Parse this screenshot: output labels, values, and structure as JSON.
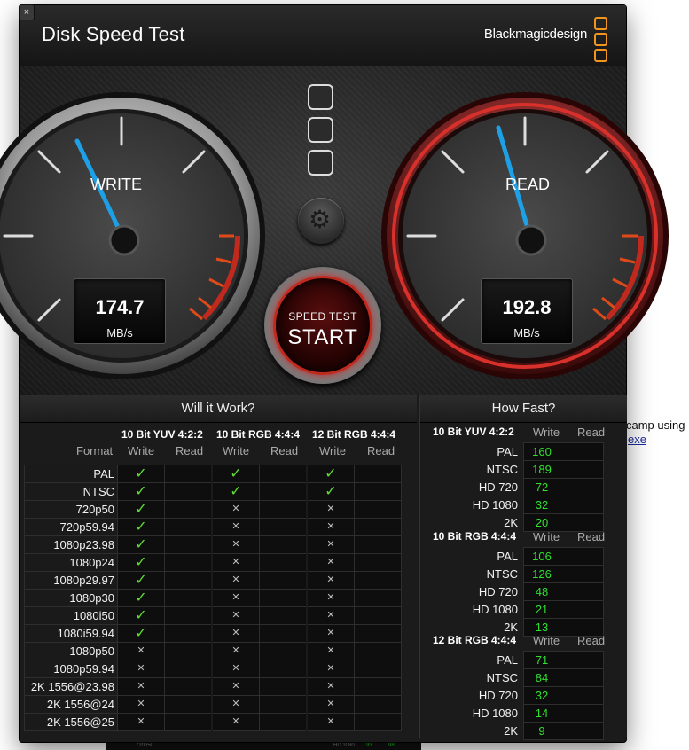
{
  "app": {
    "title": "Disk Speed Test",
    "brand": "Blackmagicdesign",
    "close_symbol": "×"
  },
  "colors": {
    "write_needle": "#1ea0e6",
    "ok_check": "#5fdc35",
    "speed_value": "#30e030",
    "start_ring": "#c0291e",
    "brand_logo": "#f0961e"
  },
  "gauges": {
    "write": {
      "label": "WRITE",
      "value": "174.7",
      "unit": "MB/s"
    },
    "read": {
      "label": "READ",
      "value": "192.8",
      "unit": "MB/s"
    }
  },
  "start_button": {
    "small": "SPEED TEST",
    "big": "START"
  },
  "will_it_work": {
    "title": "Will it Work?",
    "format_label": "Format",
    "write_label": "Write",
    "read_label": "Read",
    "groups": [
      "10 Bit YUV 4:2:2",
      "10 Bit RGB 4:4:4",
      "12 Bit RGB 4:4:4"
    ],
    "rows": [
      {
        "format": "PAL",
        "marks": [
          "ok",
          "ok",
          "ok"
        ]
      },
      {
        "format": "NTSC",
        "marks": [
          "ok",
          "ok",
          "ok"
        ]
      },
      {
        "format": "720p50",
        "marks": [
          "ok",
          "no",
          "no"
        ]
      },
      {
        "format": "720p59.94",
        "marks": [
          "ok",
          "no",
          "no"
        ]
      },
      {
        "format": "1080p23.98",
        "marks": [
          "ok",
          "no",
          "no"
        ]
      },
      {
        "format": "1080p24",
        "marks": [
          "ok",
          "no",
          "no"
        ]
      },
      {
        "format": "1080p29.97",
        "marks": [
          "ok",
          "no",
          "no"
        ]
      },
      {
        "format": "1080p30",
        "marks": [
          "ok",
          "no",
          "no"
        ]
      },
      {
        "format": "1080i50",
        "marks": [
          "ok",
          "no",
          "no"
        ]
      },
      {
        "format": "1080i59.94",
        "marks": [
          "ok",
          "no",
          "no"
        ]
      },
      {
        "format": "1080p50",
        "marks": [
          "no",
          "no",
          "no"
        ]
      },
      {
        "format": "1080p59.94",
        "marks": [
          "no",
          "no",
          "no"
        ]
      },
      {
        "format": "2K 1556@23.98",
        "marks": [
          "no",
          "no",
          "no"
        ]
      },
      {
        "format": "2K 1556@24",
        "marks": [
          "no",
          "no",
          "no"
        ]
      },
      {
        "format": "2K 1556@25",
        "marks": [
          "no",
          "no",
          "no"
        ]
      }
    ]
  },
  "how_fast": {
    "title": "How Fast?",
    "write_label": "Write",
    "read_label": "Read",
    "groups": [
      {
        "name": "10 Bit YUV 4:2:2",
        "rows": [
          {
            "format": "PAL",
            "write": "160"
          },
          {
            "format": "NTSC",
            "write": "189"
          },
          {
            "format": "HD 720",
            "write": "72"
          },
          {
            "format": "HD 1080",
            "write": "32"
          },
          {
            "format": "2K",
            "write": "20"
          }
        ]
      },
      {
        "name": "10 Bit RGB 4:4:4",
        "rows": [
          {
            "format": "PAL",
            "write": "106"
          },
          {
            "format": "NTSC",
            "write": "126"
          },
          {
            "format": "HD 720",
            "write": "48"
          },
          {
            "format": "HD 1080",
            "write": "21"
          },
          {
            "format": "2K",
            "write": "13"
          }
        ]
      },
      {
        "name": "12 Bit RGB 4:4:4",
        "rows": [
          {
            "format": "PAL",
            "write": "71"
          },
          {
            "format": "NTSC",
            "write": "84"
          },
          {
            "format": "HD 720",
            "write": "32"
          },
          {
            "format": "HD 1080",
            "write": "14"
          },
          {
            "format": "2K",
            "write": "9"
          }
        ]
      }
    ]
  },
  "background": {
    "text1": "camp using",
    "text2": "exe",
    "strip_left": "720p50",
    "strip_mid": "HD 1080",
    "strip_v1": "93",
    "strip_v2": "98"
  }
}
